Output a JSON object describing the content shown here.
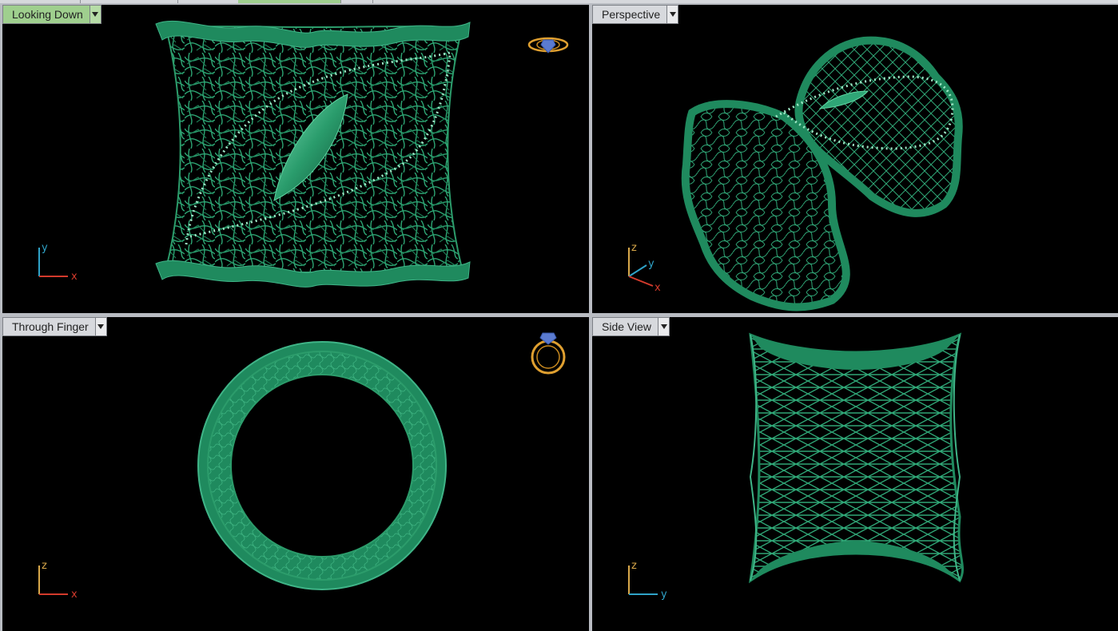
{
  "viewports": {
    "top": {
      "label": "Looking Down",
      "active": true,
      "axes": {
        "vertical": "y",
        "horizontal": "x"
      }
    },
    "perspective": {
      "label": "Perspective",
      "active": false,
      "axes": {
        "vertical": "z",
        "depth": "y",
        "horizontal": "x"
      }
    },
    "front": {
      "label": "Through Finger",
      "active": false,
      "axes": {
        "vertical": "z",
        "horizontal": "x"
      }
    },
    "side": {
      "label": "Side View",
      "active": false,
      "axes": {
        "vertical": "z",
        "horizontal": "y"
      }
    }
  },
  "colors": {
    "model": "#1f8a5e",
    "model_light": "#3fb487",
    "model_dark": "#0f5a3b",
    "wire": "#5fd3a0",
    "axis_x": "#d33a2c",
    "axis_y": "#2fa3c8",
    "axis_z": "#d8a84a",
    "gizmo": "#e0a030",
    "active_label": "#9fcf8e"
  },
  "icons": {
    "ring_side_gizmo": "ring-side-icon",
    "ring_top_gizmo": "ring-top-icon",
    "dropdown": "chevron-down-icon"
  }
}
